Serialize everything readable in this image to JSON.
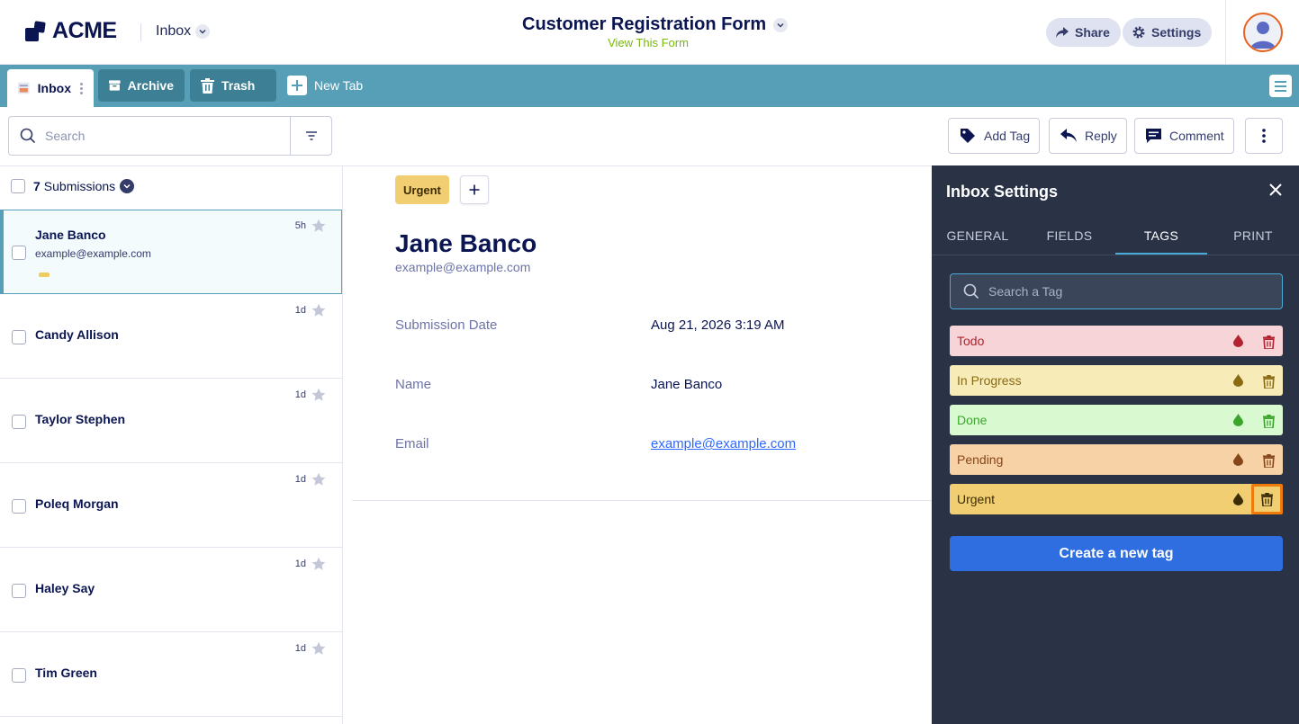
{
  "header": {
    "logo_text": "ACME",
    "inbox_label": "Inbox",
    "form_title": "Customer Registration Form",
    "view_form": "View This Form",
    "share_label": "Share",
    "settings_label": "Settings"
  },
  "tabs": {
    "inbox": "Inbox",
    "archive": "Archive",
    "trash": "Trash",
    "new_tab": "New Tab"
  },
  "toolbar": {
    "search_placeholder": "Search",
    "add_tag": "Add Tag",
    "reply": "Reply",
    "comment": "Comment"
  },
  "list": {
    "count": "7",
    "count_label": "Submissions",
    "rows": [
      {
        "name": "Jane Banco",
        "email": "example@example.com",
        "age": "5h",
        "tag_color": "#f0cc60"
      },
      {
        "name": "Candy Allison",
        "age": "1d"
      },
      {
        "name": "Taylor Stephen",
        "age": "1d"
      },
      {
        "name": "Poleq Morgan",
        "age": "1d"
      },
      {
        "name": "Haley Say",
        "age": "1d"
      },
      {
        "name": "Tim Green",
        "age": "1d"
      }
    ]
  },
  "detail": {
    "tag": "Urgent",
    "name": "Jane Banco",
    "email": "example@example.com",
    "fields": [
      {
        "label": "Submission Date",
        "value": "Aug 21, 2026 3:19 AM"
      },
      {
        "label": "Name",
        "value": "Jane Banco"
      },
      {
        "label": "Email",
        "value": "example@example.com"
      }
    ]
  },
  "panel": {
    "title": "Inbox Settings",
    "tabs": [
      "GENERAL",
      "FIELDS",
      "TAGS",
      "PRINT"
    ],
    "active_tab": "TAGS",
    "search_placeholder": "Search a Tag",
    "tags": [
      {
        "name": "Todo",
        "bg": "#f7d4d8",
        "fg": "#b2222f",
        "icon": "#b2222f"
      },
      {
        "name": "In Progress",
        "bg": "#f7ebb7",
        "fg": "#8a6a14",
        "icon": "#8a6a14"
      },
      {
        "name": "Done",
        "bg": "#d9fad0",
        "fg": "#3aa52a",
        "icon": "#3aa52a"
      },
      {
        "name": "Pending",
        "bg": "#f7d2a6",
        "fg": "#86461a",
        "icon": "#86461a"
      },
      {
        "name": "Urgent",
        "bg": "#f2ce72",
        "fg": "#3a2d05",
        "icon": "#3a2d05"
      }
    ],
    "create_label": "Create a new tag"
  },
  "colors": {
    "accent": "#579fb6",
    "panel_bg": "#293345",
    "primary_button": "#2e6ee0",
    "highlight": "#f07a0a",
    "brand_green": "#78bb07"
  }
}
